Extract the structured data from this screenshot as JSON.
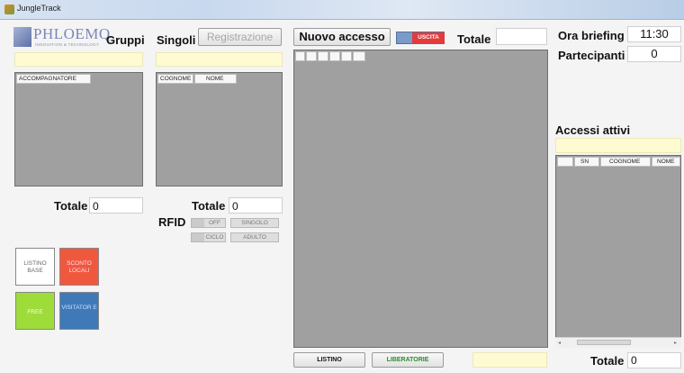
{
  "window": {
    "title": "JungleTrack"
  },
  "logo": {
    "brand": "PHLOEMQ",
    "tagline": "INNOVATION & TECHNOLOGY"
  },
  "groups": {
    "title": "Gruppi",
    "column": "ACCOMPAGNATORE",
    "total_label": "Totale",
    "total_value": "0"
  },
  "singles": {
    "title": "Singoli",
    "register_button": "Registrazione",
    "columns": [
      "COGNOME",
      "NOME"
    ],
    "total_label": "Totale",
    "total_value": "0"
  },
  "rfid": {
    "label": "RFID",
    "toggles": [
      {
        "label": "OFF"
      },
      {
        "label": "SINGOLO"
      },
      {
        "label": "CICLO"
      },
      {
        "label": "ADULTO"
      }
    ]
  },
  "tiles": [
    {
      "label": "LISTINO BASE",
      "color": "#ffffff"
    },
    {
      "label": "SCONTO LOCALI",
      "color": "#f0583e"
    },
    {
      "label": "FREE",
      "color": "#9edc3a"
    },
    {
      "label": "VISITATOR E",
      "color": "#3f79b8"
    }
  ],
  "center": {
    "new_access_button": "Nuovo accesso",
    "exit_toggle": "USCITA",
    "total_label": "Totale",
    "total_value": "",
    "list_button": "LISTINO",
    "releases_button": "LIBERATORIE",
    "colors": {
      "exit": "#e23b3b",
      "exit_track": "#7a9bc8",
      "releases_text": "#2e8a2e"
    }
  },
  "right": {
    "briefing_label": "Ora briefing",
    "briefing_time": "11:30",
    "participants_label": "Partecipanti",
    "participants_value": "0",
    "active_title": "Accessi attivi",
    "columns": [
      "SN",
      "COGNOME",
      "NOME"
    ],
    "total_label": "Totale",
    "total_value": "0"
  }
}
